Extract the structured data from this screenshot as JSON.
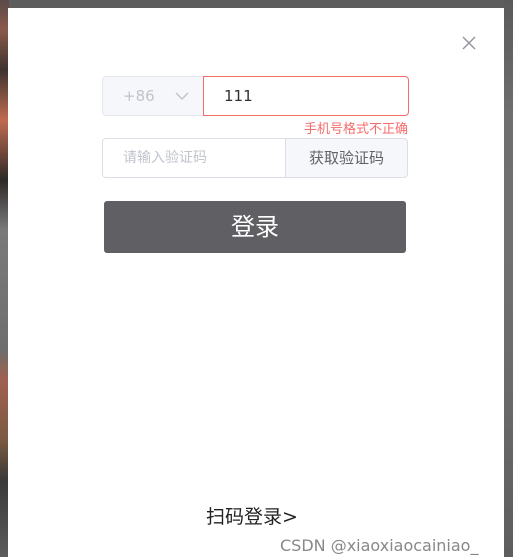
{
  "dialog": {
    "close_icon": "close-icon"
  },
  "phone": {
    "country_code": "+86",
    "chevron_icon": "chevron-down-icon",
    "value": "111",
    "error": "手机号格式不正确"
  },
  "code": {
    "placeholder": "请输入验证码",
    "value": "",
    "get_code_label": "获取验证码"
  },
  "login": {
    "label": "登录"
  },
  "qr_login": {
    "label": "扫码登录>"
  },
  "watermark": {
    "text": "CSDN @xiaoxiaocainiao_"
  },
  "colors": {
    "error": "#f56c6c",
    "login_button": "#606064",
    "overlay": "#6f6f6f"
  }
}
